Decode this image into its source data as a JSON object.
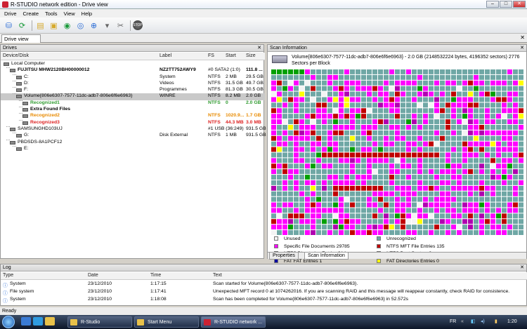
{
  "window": {
    "title": "R-STUDIO network edition - Drive view"
  },
  "menu": [
    "Drive",
    "Create",
    "Tools",
    "View",
    "Help"
  ],
  "tabs": {
    "drive_view": "Drive view"
  },
  "drives_panel": {
    "title": "Drives",
    "columns": [
      "Device/Disk",
      "Label",
      "FS",
      "Start",
      "Size"
    ],
    "rows": [
      {
        "indent": 0,
        "name": "Local Computer",
        "label": "",
        "fs": "",
        "start": "",
        "size": "",
        "style": ""
      },
      {
        "indent": 1,
        "name": "FUJITSU MHW2120BH00000012",
        "label": "NZ2TT752AWY9",
        "fs": "#0 SATA2 (1:0)",
        "start": "",
        "size": "111.8 ...",
        "style": "bold"
      },
      {
        "indent": 2,
        "name": "C:",
        "label": "System",
        "fs": "NTFS",
        "start": "2 MB",
        "size": "29.5 GB",
        "style": ""
      },
      {
        "indent": 2,
        "name": "D:",
        "label": "Videos",
        "fs": "NTFS",
        "start": "31.5 GB",
        "size": "49.7 GB",
        "style": ""
      },
      {
        "indent": 2,
        "name": "F:",
        "label": "Programmes",
        "fs": "NTFS",
        "start": "81.3 GB",
        "size": "30.5 GB",
        "style": ""
      },
      {
        "indent": 2,
        "name": "Volume{806e6307-7577-11dc-adb7-806e6f6e6963}",
        "label": "WINRE",
        "fs": "NTFS",
        "start": "8.2 MB",
        "size": "2.0 GB",
        "style": "sel"
      },
      {
        "indent": 3,
        "name": "Recognized1",
        "label": "",
        "fs": "NTFS",
        "start": "0",
        "size": "2.0 GB",
        "style": "green"
      },
      {
        "indent": 3,
        "name": "Extra Found Files",
        "label": "",
        "fs": "",
        "start": "",
        "size": "",
        "style": "bold"
      },
      {
        "indent": 3,
        "name": "Recognized2",
        "label": "",
        "fs": "NTFS",
        "start": "1020.9...",
        "size": "1.7 GB",
        "style": "orange"
      },
      {
        "indent": 3,
        "name": "Recognized3",
        "label": "",
        "fs": "NTFS",
        "start": "44.3 MB",
        "size": "3.0 MB",
        "style": "red"
      },
      {
        "indent": 1,
        "name": "SAMSUNGHD103UJ",
        "label": "",
        "fs": "#1 USB (36:249)",
        "start": "",
        "size": "931.5 GB",
        "style": ""
      },
      {
        "indent": 2,
        "name": "G:",
        "label": "Disk External",
        "fs": "NTFS",
        "start": "1 MB",
        "size": "931.5 GB",
        "style": ""
      },
      {
        "indent": 1,
        "name": "PBDSDS-8A1PCF12",
        "label": "",
        "fs": "",
        "start": "",
        "size": "",
        "style": ""
      },
      {
        "indent": 2,
        "name": "E:",
        "label": "",
        "fs": "",
        "start": "",
        "size": "",
        "style": ""
      }
    ]
  },
  "scan_panel": {
    "title": "Scan Information",
    "info": "Volume{806e6307-7577-11dc-adb7-806e6f6e6963} - 2.0 GB (2148532224 bytes, 4196352 sectors)  2776 Sectors per Block",
    "colors": {
      "unused": "#f4f4f4",
      "unrecognized": "#6fa7a5",
      "specific": "#ff00ff",
      "mft": "#c00000",
      "dir": "#b000b0",
      "boot": "#00a000",
      "fatent": "#0000a0",
      "fatdir": "#ffff00",
      "fatboot": "#904090",
      "ext2": "#00b0a0",
      "ufs": "#2020c0",
      "ufscyl": "#a02020",
      "hfsvol": "#e07000",
      "hfsbt": "#ff0090"
    },
    "legend": [
      {
        "key": "unused",
        "label": "Unused"
      },
      {
        "key": "unrecognized",
        "label": "Unrecognized"
      },
      {
        "key": "specific",
        "label": "Specific File Documents 29785"
      },
      {
        "key": "mft",
        "label": "NTFS MFT File Entries 135"
      },
      {
        "key": "dir",
        "label": "NTFS Directories Entries 314"
      },
      {
        "key": "boot",
        "label": "NTFS Boot Sectors 2"
      },
      {
        "key": "fatent",
        "label": "FAT FAT Entries 1"
      },
      {
        "key": "fatdir",
        "label": "FAT Directories Entries 0"
      },
      {
        "key": "fatboot",
        "label": "FAT Boot Sectors 2"
      },
      {
        "key": "ext2",
        "label": "Ext2FS SuperBlock 0"
      },
      {
        "key": "ufs",
        "label": "UFS/FFS SuperBlock 0"
      },
      {
        "key": "ufscyl",
        "label": "UFS/FFS CylinderGroup 0"
      },
      {
        "key": "hfsvol",
        "label": "HFS/HFS+ VolumeHeader 0"
      },
      {
        "key": "hfsbt",
        "label": "HFS/HFS+ BTree+Node 1"
      }
    ],
    "tabs": [
      "Properties",
      "Scan Information"
    ]
  },
  "log_panel": {
    "title": "Log",
    "columns": [
      "Type",
      "Date",
      "Time",
      "Text"
    ],
    "rows": [
      {
        "type": "System",
        "date": "23/12/2010",
        "time": "1:17:15",
        "text": "Scan started for Volume{806e6307-7577-11dc-adb7-806e6f6e6963}."
      },
      {
        "type": "File system",
        "date": "23/12/2010",
        "time": "1:17:41",
        "text": "Unexpected MFT record 0 at 1074262016. If you are scanning RAID and this message will reappear constantly, check RAID for consistence."
      },
      {
        "type": "System",
        "date": "23/12/2010",
        "time": "1:18:08",
        "text": "Scan has been completed for Volume{806e6307-7577-11dc-adb7-806e6f6e6963} in 52.572s"
      }
    ]
  },
  "status": "Ready",
  "taskbar": {
    "tasks": [
      "R-Studio",
      "Start Menu",
      "R-STUDIO network ..."
    ],
    "lang": "FR",
    "clock": "1:20"
  }
}
